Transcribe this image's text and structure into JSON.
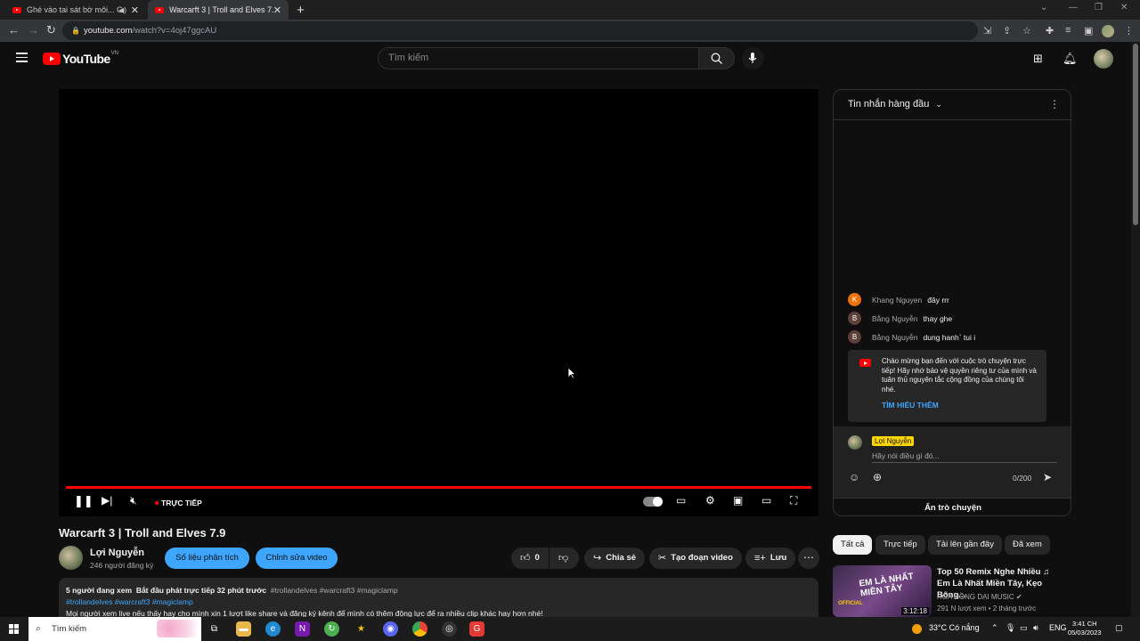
{
  "browser": {
    "tabs": [
      {
        "title": "Ghé vào tai sát bờ môi... Ghé",
        "active": false
      },
      {
        "title": "Warcarft 3 | Troll and Elves 7.9 - Y",
        "active": true
      }
    ],
    "url_domain": "youtube.com",
    "url_path": "/watch?v=4oj47ggcAU"
  },
  "header": {
    "logo_text": "YouTube",
    "region": "VN",
    "search_placeholder": "Tìm kiếm"
  },
  "player": {
    "live_label": "TRỰC TIẾP",
    "progress_fraction": 1.0
  },
  "video": {
    "title": "Warcarft 3 | Troll and Elves 7.9",
    "channel_name": "Lợi Nguyễn",
    "subscribers": "246 người đăng ký",
    "analytics_button": "Số liệu phân tích",
    "edit_button": "Chỉnh sửa video",
    "like_count": "0",
    "share_label": "Chia sẻ",
    "clip_label": "Tạo đoạn video",
    "save_label": "Lưu"
  },
  "description": {
    "viewers": "5 người đang xem",
    "started": "Bắt đầu phát trực tiếp 32 phút trước",
    "tags_inline": "#trollandelves #warcraft3 #magiclamp",
    "tags_line": "#trollandelves #warcraft3 #magiclamp",
    "body": "Mọi người xem live nếu thấy hay cho mình xin 1 lượt like share và đăng ký kênh để mình có thêm động lực để ra nhiều clip khác hay hơn nhé!"
  },
  "chat": {
    "header": "Tin nhắn hàng đầu",
    "messages": [
      {
        "initial": "K",
        "author": "Khang Nguyen",
        "text": "đây rrr",
        "color": "#e8710a"
      },
      {
        "initial": "B",
        "author": "Bằng Nguyễn",
        "text": "thay ghe",
        "color": "#5d4037"
      },
      {
        "initial": "B",
        "author": "Bằng Nguyễn",
        "text": "dung hanh` tui i",
        "color": "#5d4037"
      }
    ],
    "notice": "Chào mừng bạn đến với cuộc trò chuyện trực tiếp! Hãy nhớ bảo vệ quyền riêng tư của mình và tuân thủ nguyên tắc cộng đồng của chúng tôi nhé.",
    "learn_more": "TÌM HIỂU THÊM",
    "my_name": "Lợi Nguyễn",
    "input_placeholder": "Hãy nói điều gì đó...",
    "counter": "0/200",
    "hide_chat": "Ẩn trò chuyện"
  },
  "chips": [
    "Tất cả",
    "Trực tiếp",
    "Tải lên gần đây",
    "Đã xem"
  ],
  "recommended": {
    "title": "Top 50 Remix Nghe Nhiều ♫ Em Là Nhất Miền Tây, Kẹo Bông...",
    "channel": "HOA HỒNG DẠI MUSIC",
    "meta": "291 N lượt xem • 2 tháng trước",
    "duration": "3:12:18",
    "thumb_text": "EM LÀ NHẤT MIỀN TÂY",
    "thumb_badge": "OFFICIAL"
  },
  "taskbar": {
    "search_placeholder": "Tìm kiếm",
    "weather": "33°C Có nắng",
    "lang": "ENG",
    "time": "3:41 CH",
    "date": "05/03/2023"
  }
}
